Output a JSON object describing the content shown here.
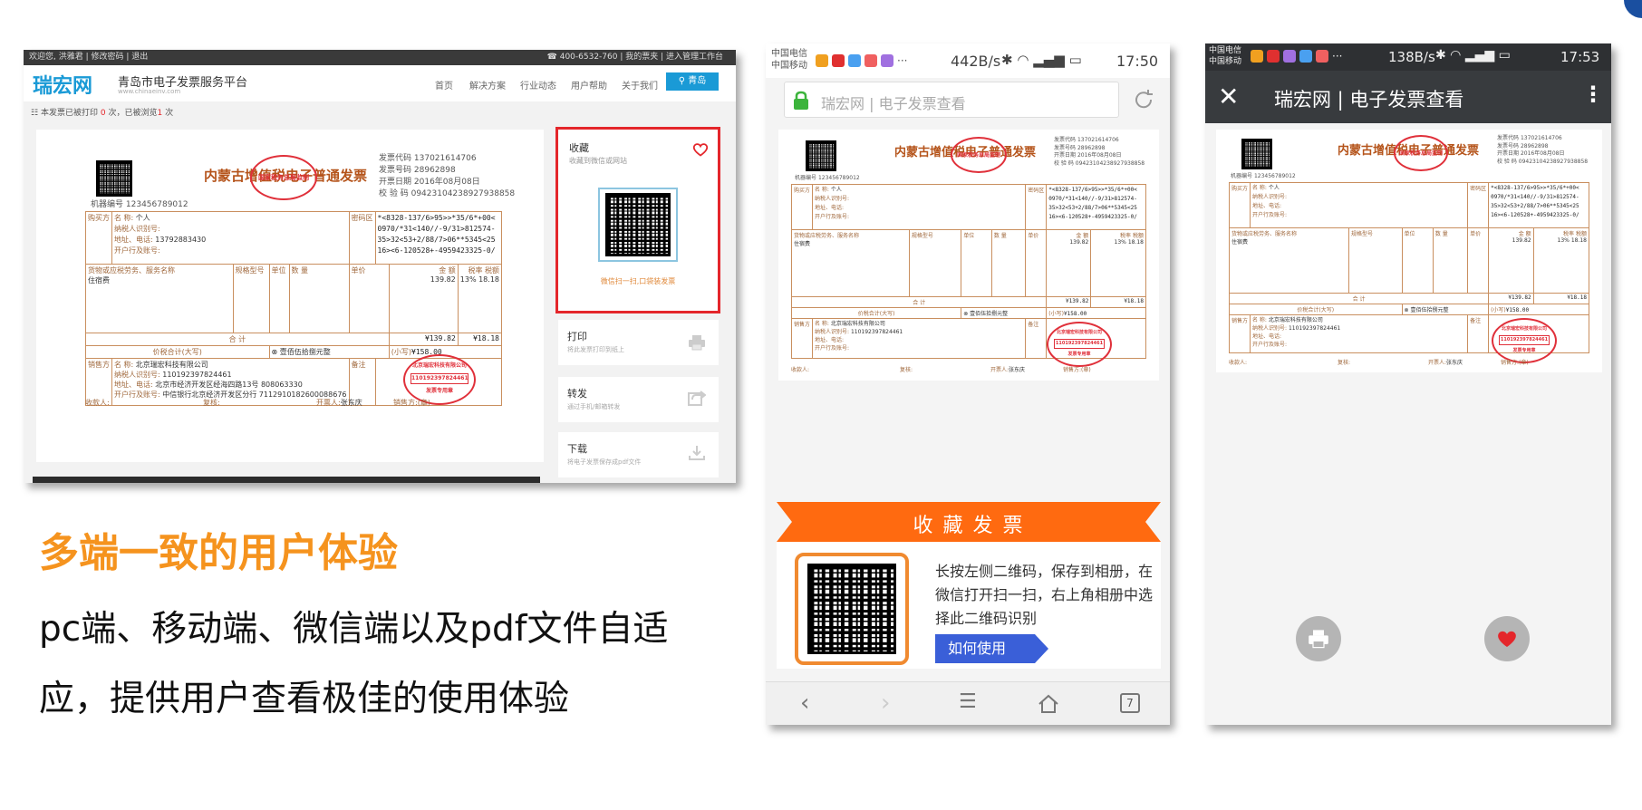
{
  "pc": {
    "top_left": "欢迎您, 洪雅君 | 修改密码 | 退出",
    "top_right": "☎ 400-6532-760 | 我的票夹 | 进入管理工作台",
    "logo": "瑞宏网",
    "logo_sub": "www.chinaeinv.com",
    "platform_title": "青岛市电子发票服务平台",
    "nav": [
      "首页",
      "解决方案",
      "行业动态",
      "用户帮助",
      "关于我们"
    ],
    "city": "青岛",
    "print_notice_prefix": "本发票已被打印",
    "print_count": "0",
    "print_notice_mid": "次，已被浏览",
    "view_count": "1",
    "print_notice_suffix": "次",
    "side": {
      "collect_title": "收藏",
      "collect_sub": "收藏到微信或网站",
      "qr_caption": "微信扫一扫,口袋装发票",
      "print_title": "打印",
      "print_sub": "将此发票打印到纸上",
      "forward_title": "转发",
      "forward_sub": "通过手机/邮箱转发",
      "download_title": "下载",
      "download_sub": "将电子发票保存成pdf文件"
    }
  },
  "invoice": {
    "title": "内蒙古增值税电子普通发票",
    "code_label": "发票代码",
    "code": "137021614706",
    "number_label": "发票号码",
    "number": "28962898",
    "date_label": "开票日期",
    "date": "2016年08月08日",
    "check_label": "校 验 码",
    "check": "09423104238927938858",
    "machine_label": "机器编号",
    "machine": "123456789012",
    "buyer_side": "购买方",
    "buyer_name_label": "名 称:",
    "buyer_name": "个人",
    "buyer_tax_label": "纳税人识别号:",
    "buyer_addr_label": "地址、电话:",
    "buyer_addr": "13792883430",
    "buyer_bank_label": "开户行及账号:",
    "cipher_side": "密码区",
    "cipher": [
      "*<8328-137/6>95>>*35/6*+00<",
      "0970/*31<140//-9/31>812574-",
      "35>32<53+2/88/7>06**5345<25",
      "16><6-120528+-4959423325-0/"
    ],
    "col_item": "货物或应税劳务、服务名称",
    "col_spec": "规格型号",
    "col_unit": "单位",
    "col_qty": "数 量",
    "col_price": "单价",
    "col_amount": "金 额",
    "col_rate": "税率",
    "col_tax": "税额",
    "item_name": "住宿费",
    "item_amount": "139.82",
    "item_rate": "13%",
    "item_tax": "18.18",
    "total_label": "合 计",
    "total_amount": "¥139.82",
    "total_tax": "¥18.18",
    "sum_label": "价税合计(大写)",
    "sum_words": "⊗ 壹佰伍拾捌元整",
    "sum_small_label": "(小写)",
    "sum_small": "¥158.00",
    "seller_side": "销售方",
    "seller_name_label": "名 称:",
    "seller_name": "北京瑞宏科技有限公司",
    "seller_tax_label": "纳税人识别号:",
    "seller_tax": "110192397824461",
    "seller_addr_label": "地址、电话:",
    "seller_addr": "北京市经济开发区经海四路13号 808063330",
    "seller_bank_label": "开户行及账号:",
    "seller_bank": "中信银行北京经济开发区分行 7112910182600088676",
    "remark_side": "备注",
    "payee_label": "收款人:",
    "reviewer_label": "复核:",
    "issuer_label": "开票人:",
    "issuer": "张东庆",
    "seller_sign_label": "销售方:(章)",
    "stamp_top": "全国统一发票监制章",
    "stamp_bottom": "国家税务总局监制",
    "seller_stamp_text": "北京瑞宏科技有限公司",
    "seller_stamp_no": "110192397824461",
    "seller_stamp_bottom": "发票专用章"
  },
  "headline": "多端一致的用户体验",
  "description": "pc端、移动端、微信端以及pdf文件自适应，提供用户查看极佳的使用体验",
  "mobile": {
    "carrier1": "中国电信",
    "carrier2": "中国移动",
    "speed": "442B/s",
    "time": "17:50",
    "url_bar": "瑞宏网 | 电子发票查看",
    "banner": "收 藏 发 票",
    "collect_text": "长按左侧二维码，保存到相册，在微信打开扫一扫，右上角相册中选择此二维码识别",
    "how_button": "如何使用",
    "tab_count": "7"
  },
  "wechat": {
    "carrier1": "中国电信",
    "carrier2": "中国移动",
    "speed": "138B/s",
    "time": "17:53",
    "title": "瑞宏网 | 电子发票查看"
  },
  "colors": {
    "orange": "#f5931e",
    "banner_orange": "#ff6a10",
    "pc_blue": "#1a9ad6",
    "red_highlight": "#e4262b",
    "invoice_brown": "#a0683c",
    "stamp_red": "#e0303a",
    "wechat_bar": "#383b3e"
  }
}
